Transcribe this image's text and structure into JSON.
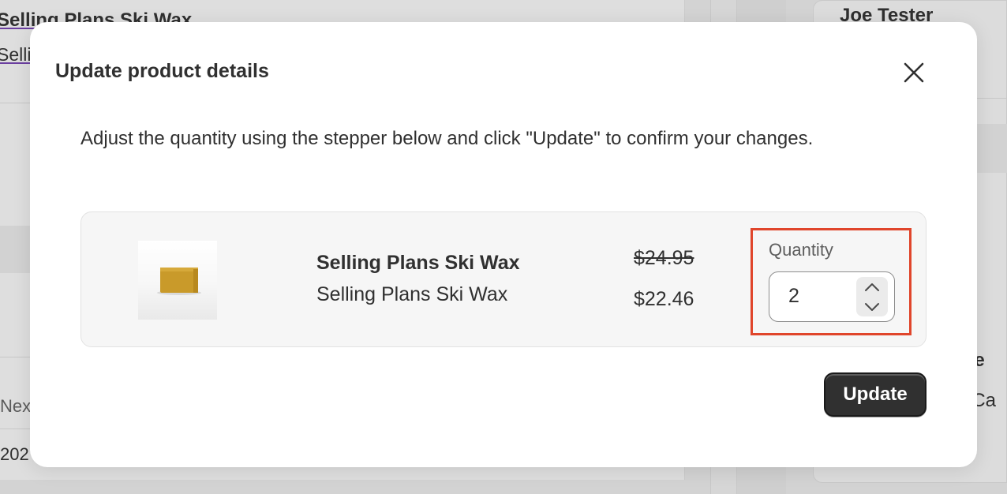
{
  "background": {
    "product_title": "Selling Plans Ski Wax",
    "product_sub": "Selli",
    "customer_name": "Joe Tester",
    "next_label": "Nex",
    "year_fragment": "202",
    "address_fragment": "nue",
    "address_fragment_2": ", Ca"
  },
  "modal": {
    "title": "Update product details",
    "close_icon": "close-icon",
    "description": "Adjust the quantity using the stepper below and click \"Update\" to confirm your changes.",
    "product": {
      "name": "Selling Plans Ski Wax",
      "variant": "Selling Plans Ski Wax",
      "original_price": "$24.95",
      "current_price": "$22.46",
      "image_icon": "ski-wax-image"
    },
    "quantity": {
      "label": "Quantity",
      "value": "2",
      "up_icon": "chevron-up-icon",
      "down_icon": "chevron-down-icon",
      "highlight_color": "#e0452b"
    },
    "update_label": "Update"
  },
  "colors": {
    "primary_button": "#303030",
    "overlay": "#d3d3d3",
    "modal_bg": "#ffffff",
    "card_bg": "#f6f6f6"
  }
}
